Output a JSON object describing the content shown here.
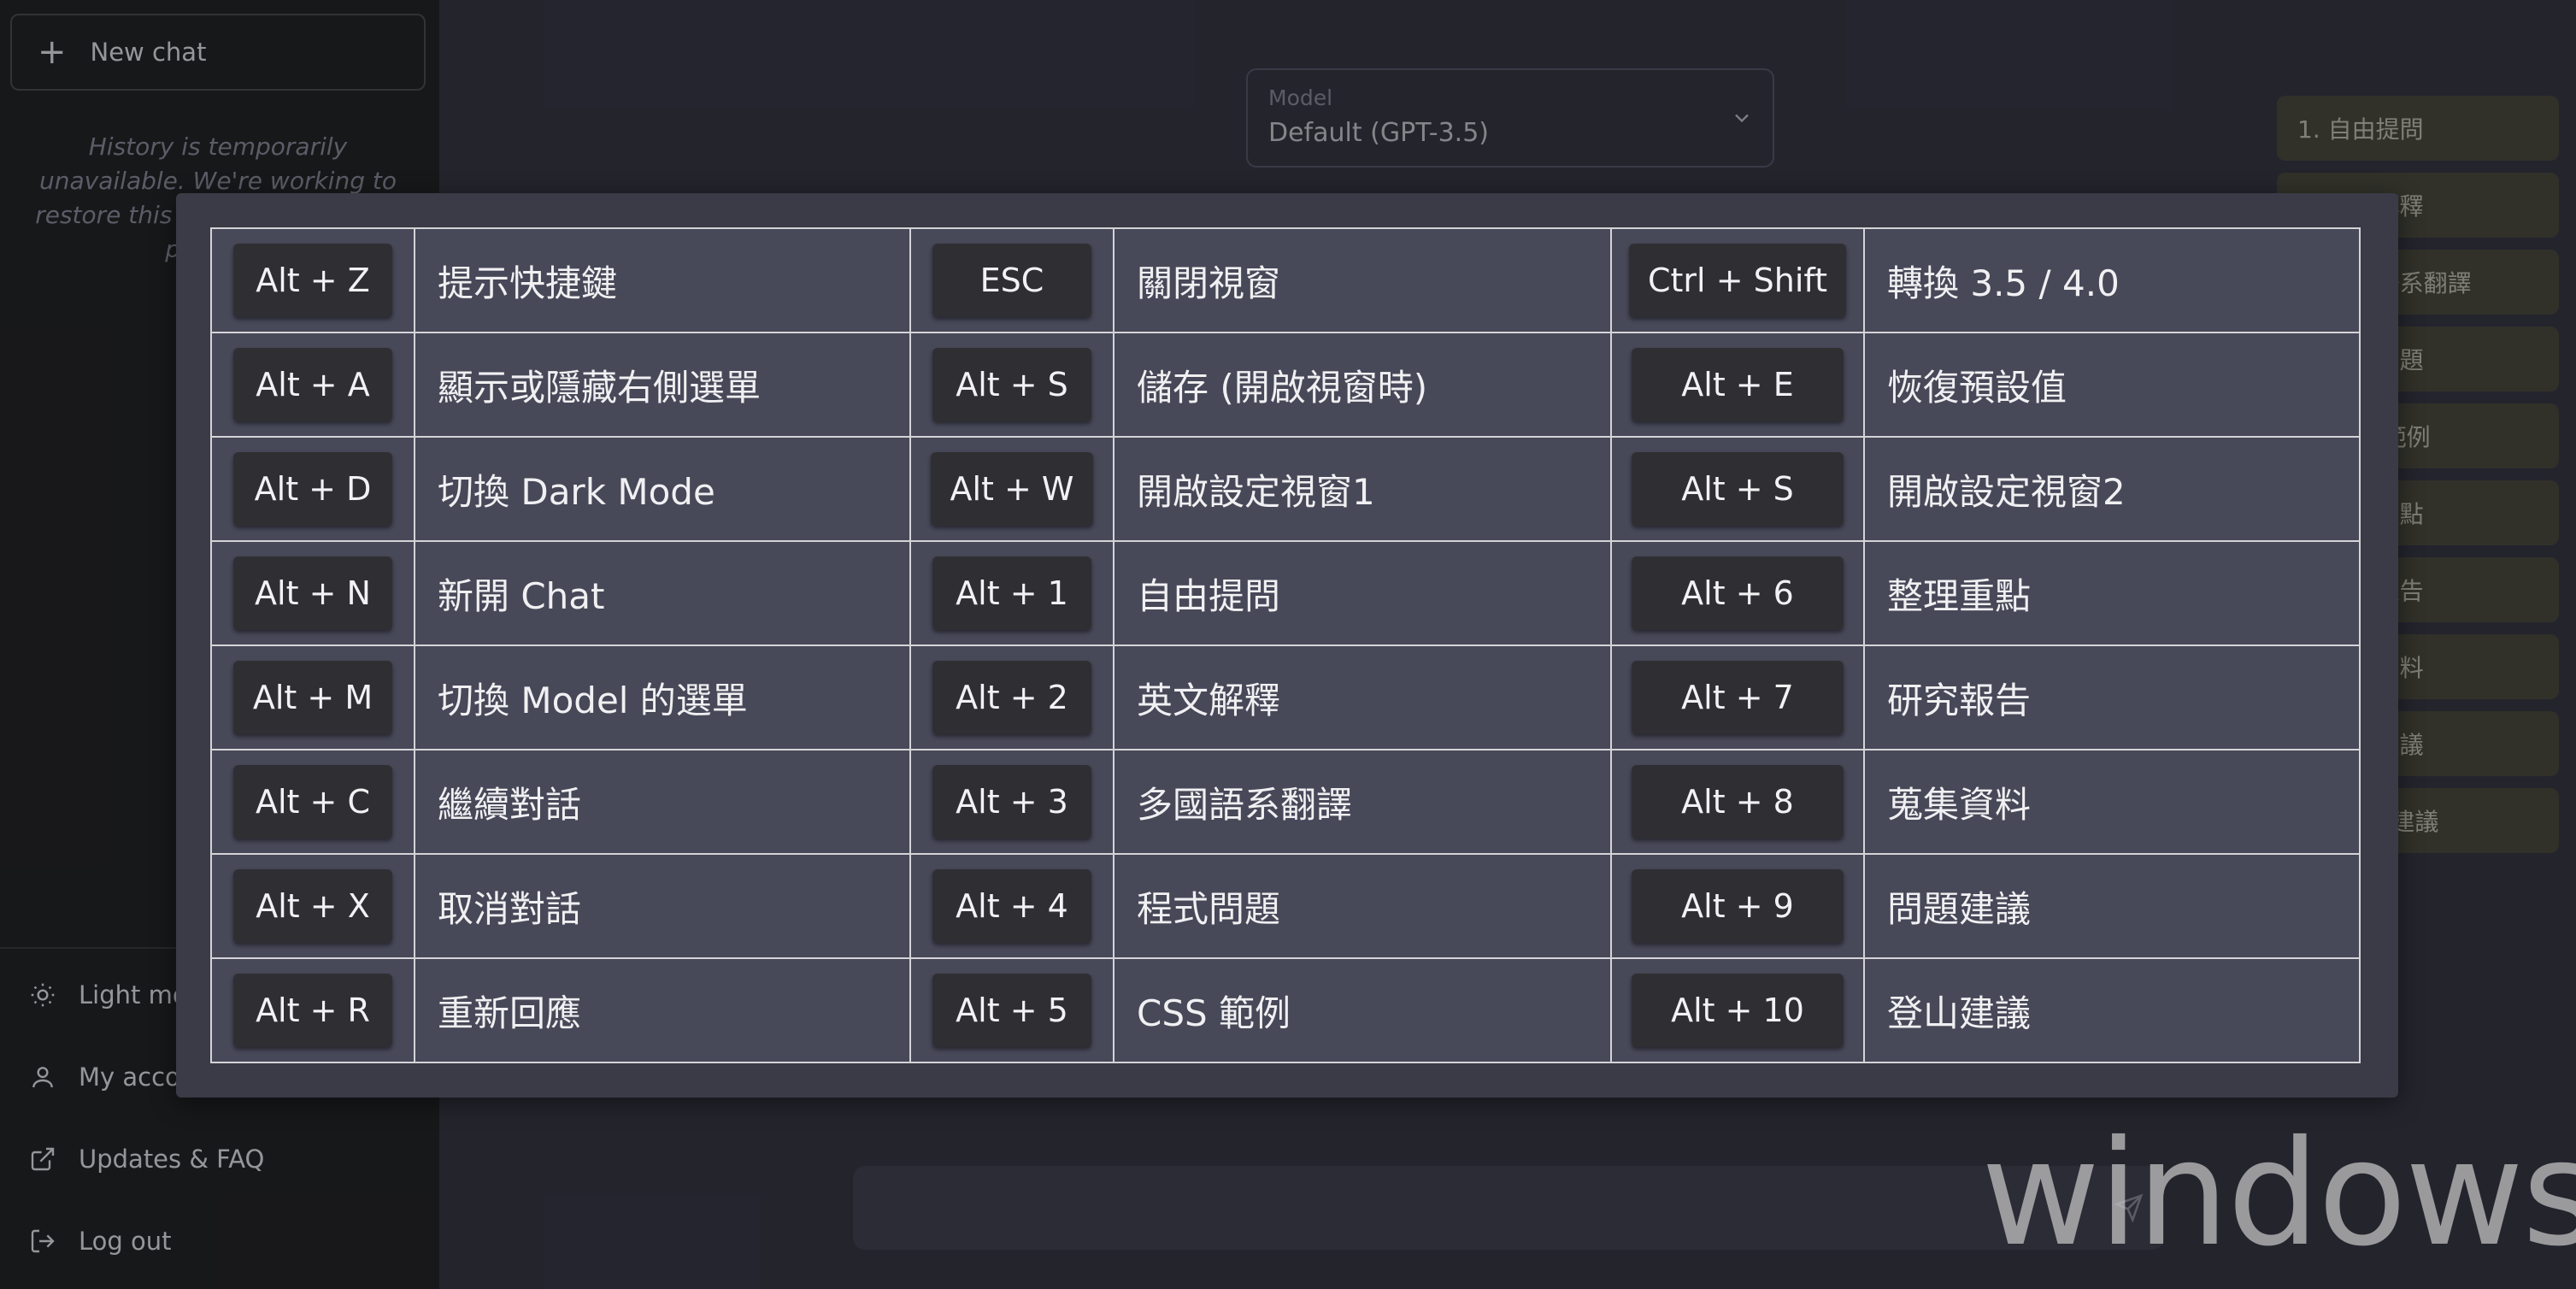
{
  "sidebar": {
    "new_chat": "New chat",
    "history_note": "History is temporarily unavailable. We're working to restore this feature as soon as possible.",
    "items": [
      {
        "label": "Light mode",
        "icon": "sun-icon"
      },
      {
        "label": "My account",
        "icon": "user-icon"
      },
      {
        "label": "Updates & FAQ",
        "icon": "external-link-icon"
      },
      {
        "label": "Log out",
        "icon": "log-out-icon"
      }
    ]
  },
  "model": {
    "caption": "Model",
    "value": "Default (GPT-3.5)"
  },
  "prompt_panel": {
    "items": [
      "1. 自由提問",
      "2. 英文解釋",
      "3. 多國語系翻譯",
      "4. 程式問題",
      "5. CSS 範例",
      "6. 整理重點",
      "7. 研究報告",
      "8. 蒐集資料",
      "9. 問題建議",
      "10. 登山建議"
    ]
  },
  "shortcuts": {
    "rows": [
      [
        {
          "key": "Alt + Z",
          "desc": "提示快捷鍵"
        },
        {
          "key": "ESC",
          "desc": "關閉視窗"
        },
        {
          "key": "Ctrl + Shift",
          "desc": "轉換 3.5 / 4.0"
        }
      ],
      [
        {
          "key": "Alt + A",
          "desc": "顯示或隱藏右側選單"
        },
        {
          "key": "Alt + S",
          "desc": "儲存 (開啟視窗時)"
        },
        {
          "key": "Alt + E",
          "desc": "恢復預設值"
        }
      ],
      [
        {
          "key": "Alt + D",
          "desc": "切換 Dark Mode"
        },
        {
          "key": "Alt + W",
          "desc": "開啟設定視窗1"
        },
        {
          "key": "Alt + S",
          "desc": "開啟設定視窗2"
        }
      ],
      [
        {
          "key": "Alt + N",
          "desc": "新開 Chat"
        },
        {
          "key": "Alt + 1",
          "desc": "自由提問"
        },
        {
          "key": "Alt + 6",
          "desc": "整理重點"
        }
      ],
      [
        {
          "key": "Alt + M",
          "desc": "切換 Model 的選單"
        },
        {
          "key": "Alt + 2",
          "desc": "英文解釋"
        },
        {
          "key": "Alt + 7",
          "desc": "研究報告"
        }
      ],
      [
        {
          "key": "Alt + C",
          "desc": "繼續對話"
        },
        {
          "key": "Alt + 3",
          "desc": "多國語系翻譯"
        },
        {
          "key": "Alt + 8",
          "desc": "蒐集資料"
        }
      ],
      [
        {
          "key": "Alt + X",
          "desc": "取消對話"
        },
        {
          "key": "Alt + 4",
          "desc": "程式問題"
        },
        {
          "key": "Alt + 9",
          "desc": "問題建議"
        }
      ],
      [
        {
          "key": "Alt + R",
          "desc": "重新回應"
        },
        {
          "key": "Alt + 5",
          "desc": "CSS 範例"
        },
        {
          "key": "Alt + 10",
          "desc": "登山建議"
        }
      ]
    ]
  },
  "watermark": "windows",
  "colors": {
    "sidebar_bg": "#202123",
    "main_bg": "#343541",
    "modal_bg": "#3a3b46",
    "cell_bg": "#474858",
    "key_bg": "#2f2f33",
    "prompt_btn_bg": "#4a4a3c"
  }
}
